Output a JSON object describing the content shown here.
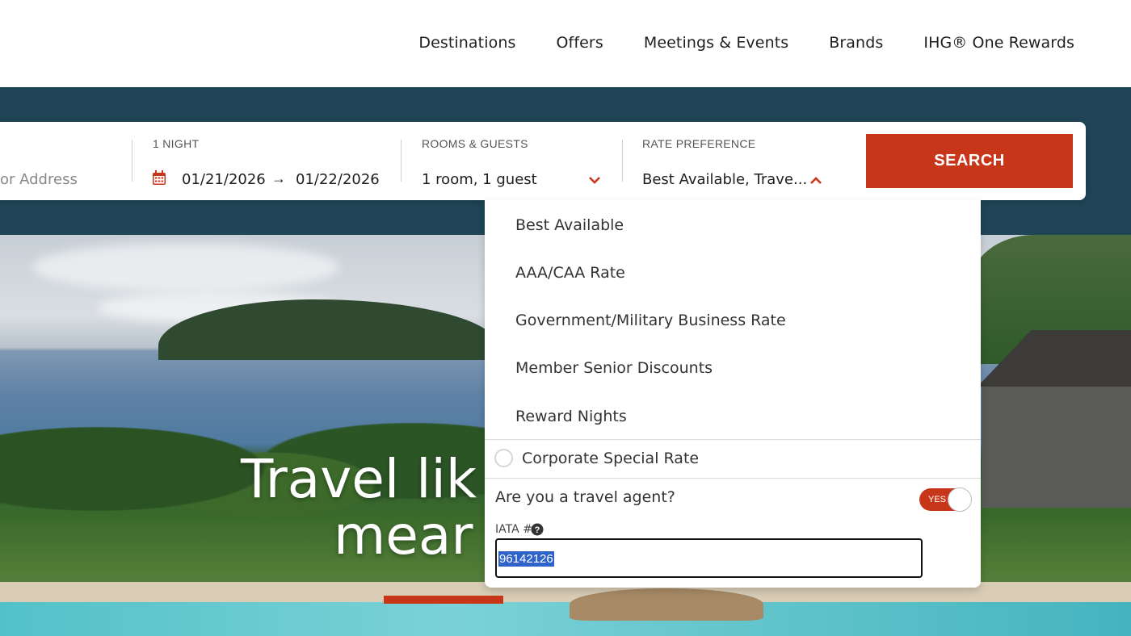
{
  "nav": {
    "items": [
      "Destinations",
      "Offers",
      "Meetings & Events",
      "Brands",
      "IHG® One Rewards"
    ]
  },
  "search": {
    "location_placeholder": "or Address",
    "nights_label": "1 NIGHT",
    "checkin": "01/21/2026",
    "arrow": "→",
    "checkout": "01/22/2026",
    "rooms_label": "ROOMS & GUESTS",
    "rooms_value": "1 room, 1 guest",
    "rate_label": "RATE PREFERENCE",
    "rate_value": "Best Available, Trave...",
    "search_button": "SEARCH"
  },
  "rate_dropdown": {
    "options": [
      "Best Available",
      "AAA/CAA Rate",
      "Government/Military Business Rate",
      "Member Senior Discounts",
      "Reward Nights"
    ],
    "corporate_label": "Corporate Special Rate",
    "agent_question": "Are you a travel agent?",
    "toggle_label": "YES",
    "iata_label": "IATA #",
    "iata_value": "96142126"
  },
  "hero": {
    "line1": "Travel lik",
    "line2": "mear"
  },
  "colors": {
    "accent": "#c8361a",
    "band": "#1f4557"
  }
}
